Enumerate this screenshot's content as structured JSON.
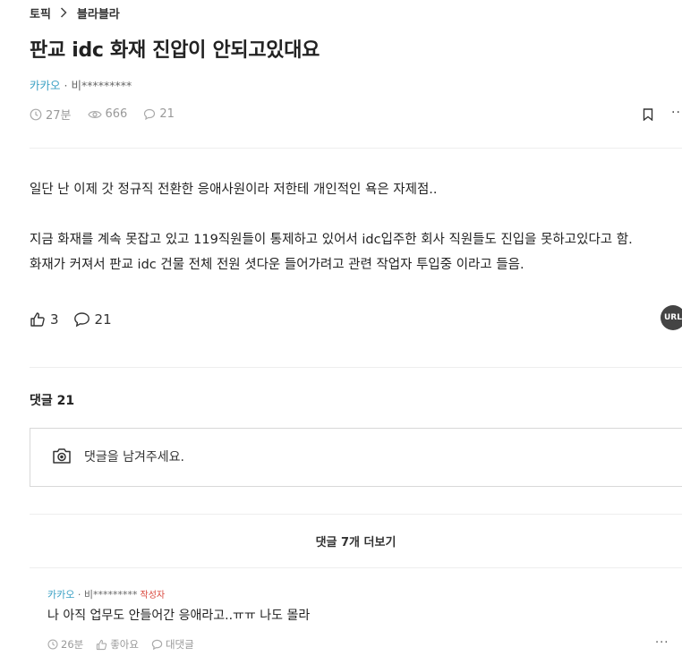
{
  "breadcrumb": {
    "topic": "토픽",
    "board": "블라블라"
  },
  "post": {
    "title": "판교 idc 화재 진압이 안되고있대요",
    "company": "카카오",
    "separator": " · ",
    "author": "비*********",
    "time": "27분",
    "views": "666",
    "comments": "21",
    "body": [
      "일단 난 이제 갓 정규직 전환한 응애사원이라 저한테 개인적인 욕은 자제점..",
      "지금 화재를 계속 못잡고 있고 119직원들이 통제하고 있어서 idc입주한 회사 직원들도 진입을 못하고있다고 함.",
      "화재가 커져서 판교 idc 건물 전체 전원 셧다운 들어가려고 관련 작업자 투입중 이라고 들음."
    ],
    "likes": "3",
    "reply_count": "21",
    "url_label": "URL",
    "more_label": "··"
  },
  "comments_section": {
    "header": "댓글 21",
    "input_placeholder": "댓글을 남겨주세요.",
    "load_more": "댓글 7개 더보기"
  },
  "comment": {
    "company": "카카오",
    "separator": " · ",
    "author": "비*********",
    "writer_badge": "작성자",
    "text": "나 아직 업무도 안들어간 응애라고..ㅠㅠ 나도 몰라",
    "time": "26분",
    "like_label": "좋아요",
    "reply_label": "대댓글",
    "more_label": "···"
  }
}
